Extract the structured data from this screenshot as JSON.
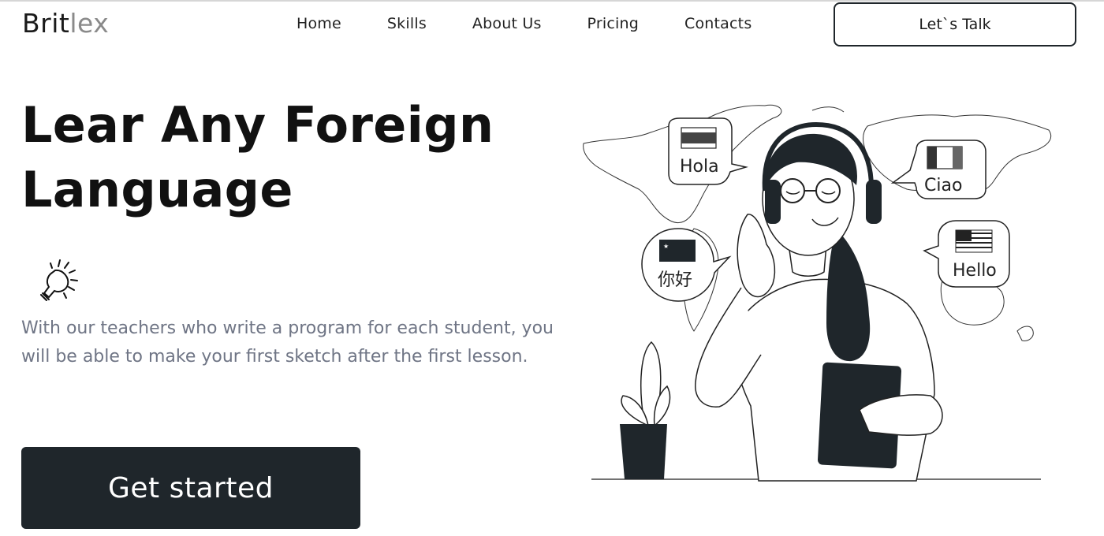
{
  "header": {
    "logo_part1": "Brit",
    "logo_part2": "lex",
    "nav": [
      "Home",
      "Skills",
      "About Us",
      "Pricing",
      "Contacts"
    ],
    "talk_button": "Let`s Talk"
  },
  "hero": {
    "title_line1": "Lear Any Foreign",
    "title_line2": "Language",
    "description": "With our teachers who write a program for each student, you will be able to make your first sketch after the first lesson.",
    "cta_label": "Get started"
  },
  "illustration": {
    "bubbles": [
      "Hola",
      "Ciao",
      "你好",
      "Hello"
    ]
  },
  "colors": {
    "dark": "#1f262b",
    "muted_text": "#6f7585",
    "logo_gray": "#8a8a8a"
  }
}
